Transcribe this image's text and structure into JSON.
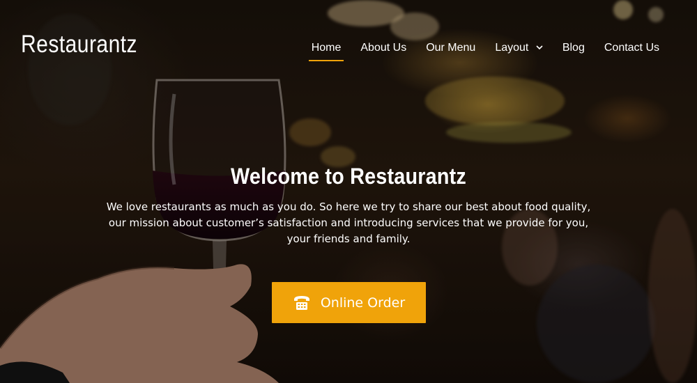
{
  "brand": {
    "name": "Restaurantz"
  },
  "nav": {
    "items": [
      {
        "label": "Home",
        "active": true
      },
      {
        "label": "About Us"
      },
      {
        "label": "Our Menu"
      },
      {
        "label": "Layout",
        "has_dropdown": true
      },
      {
        "label": "Blog"
      },
      {
        "label": "Contact Us"
      }
    ]
  },
  "hero": {
    "title": "Welcome to Restaurantz",
    "text": "We love restaurants as much as you do. So here we try to share our best about food quality, our mission about customer’s satisfaction and introducing services that we provide for you, your friends and family."
  },
  "cta": {
    "label": "Online Order",
    "icon": "telephone-icon"
  },
  "colors": {
    "accent": "#f0a30a",
    "text": "#ffffff"
  }
}
